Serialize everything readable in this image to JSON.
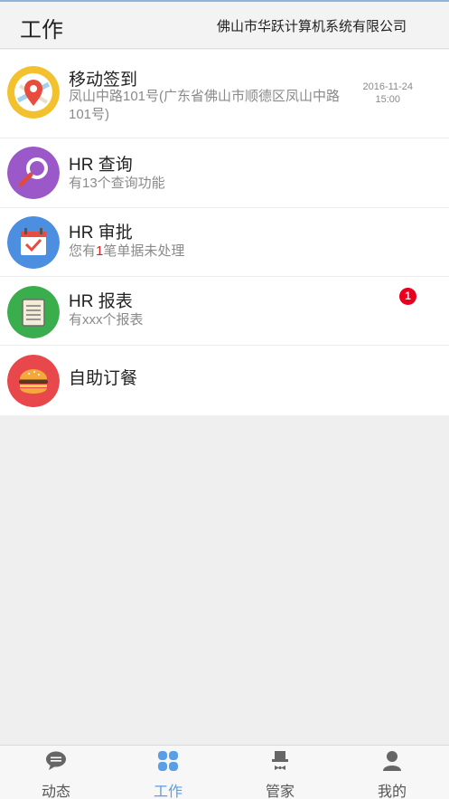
{
  "header": {
    "title": "工作",
    "company": "佛山市华跃计算机系统有限公司"
  },
  "items": [
    {
      "name": "移动签到",
      "desc": "凤山中路101号(广东省佛山市顺德区凤山中路101号)",
      "time_date": "2016-11-24",
      "time_clock": "15:00",
      "icon": "map-pin-icon",
      "icon_color": "#f3c12d"
    },
    {
      "name": "HR 查询",
      "desc": "有13个查询功能",
      "icon": "magnifier-icon",
      "icon_color": "#9a58c8"
    },
    {
      "name": "HR 审批",
      "desc_prefix": "您有",
      "desc_count": "1",
      "desc_suffix": "笔单据未处理",
      "badge": "1",
      "icon": "calendar-check-icon",
      "icon_color": "#4c8ee0"
    },
    {
      "name": "HR 报表",
      "desc": "有xxx个报表",
      "icon": "notepad-icon",
      "icon_color": "#3aad4c"
    },
    {
      "name": "自助订餐",
      "desc": "",
      "icon": "burger-icon",
      "icon_color": "#e8474b"
    }
  ],
  "tabs": [
    {
      "label": "动态",
      "icon": "chat-bubble-icon",
      "active": false
    },
    {
      "label": "工作",
      "icon": "grid-icon",
      "active": true
    },
    {
      "label": "管家",
      "icon": "butler-icon",
      "active": false
    },
    {
      "label": "我的",
      "icon": "person-icon",
      "active": false
    }
  ],
  "colors": {
    "accent": "#5a9ee6",
    "badge": "#e8001c"
  }
}
